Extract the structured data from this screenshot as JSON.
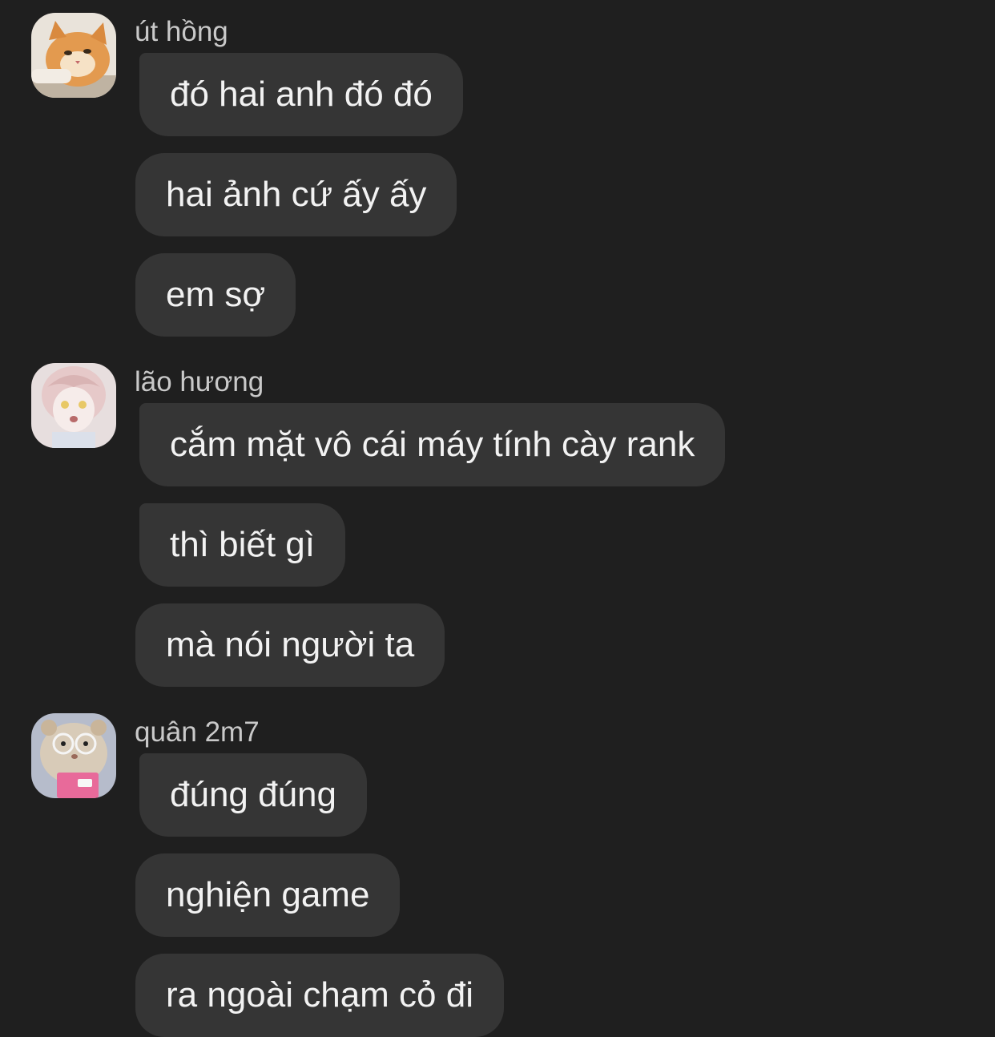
{
  "conversation": {
    "groups": [
      {
        "sender": "út hồng",
        "avatar_icon": "orange-cat-avatar-icon",
        "messages": [
          "đó hai anh đó đó",
          "hai ảnh cứ ấy ấy",
          "em sợ"
        ]
      },
      {
        "sender": "lão hương",
        "avatar_icon": "anime-girl-avatar-icon",
        "messages": [
          "cắm mặt vô cái máy tính cày rank",
          "thì biết gì",
          "mà nói người ta"
        ]
      },
      {
        "sender": "quân 2m7",
        "avatar_icon": "hamster-with-glasses-avatar-icon",
        "messages": [
          "đúng đúng",
          "nghiện game",
          "ra ngoài chạm cỏ đi"
        ]
      }
    ]
  },
  "colors": {
    "background": "#1f1f1f",
    "bubble": "#353535",
    "message_text": "#f2f2f2",
    "sender_text": "#c9c9c9"
  }
}
